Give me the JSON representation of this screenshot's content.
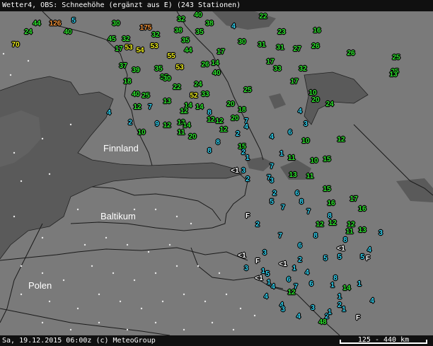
{
  "header": {
    "title": "Wetter4, OBS: Schneehöhe (ergänzt aus E) (243 Stationen)"
  },
  "footer": {
    "timestamp": "Sa, 19.12.2015 06:00z (c) MeteoGroup",
    "scale": "125 - 440 km"
  },
  "regions": [
    {
      "name": "Finnland",
      "label": "Finnland"
    },
    {
      "name": "Baltikum",
      "label": "Baltikum"
    },
    {
      "name": "Polen",
      "label": "Polen"
    }
  ],
  "colors": {
    "land": "#7a7a7a",
    "sea": "#5c5c5c",
    "cyan": "#33d6f5",
    "green": "#2ee62e",
    "yellow": "#f0f01e",
    "orange": "#f5963c",
    "white": "#ffffff"
  },
  "observations": [
    {
      "v": "44",
      "c": "green"
    },
    {
      "v": "126",
      "c": "orange"
    },
    {
      "v": "5",
      "c": "cyan"
    },
    {
      "v": "24",
      "c": "green"
    },
    {
      "v": "40",
      "c": "green"
    },
    {
      "v": "70",
      "c": "yellow"
    },
    {
      "v": "30",
      "c": "green"
    },
    {
      "v": "175",
      "c": "orange"
    },
    {
      "v": "32",
      "c": "green"
    },
    {
      "v": "40",
      "c": "green"
    },
    {
      "v": "38",
      "c": "green"
    },
    {
      "v": "22",
      "c": "green"
    },
    {
      "v": "32",
      "c": "green"
    },
    {
      "v": "38",
      "c": "green"
    },
    {
      "v": "35",
      "c": "green"
    },
    {
      "v": "4",
      "c": "cyan"
    },
    {
      "v": "16",
      "c": "green"
    },
    {
      "v": "23",
      "c": "green"
    },
    {
      "v": "45",
      "c": "green"
    },
    {
      "v": "32",
      "c": "green"
    },
    {
      "v": "31",
      "c": "green"
    },
    {
      "v": "17",
      "c": "green"
    },
    {
      "v": "53",
      "c": "yellow"
    },
    {
      "v": "54",
      "c": "yellow"
    },
    {
      "v": "53",
      "c": "yellow"
    },
    {
      "v": "35",
      "c": "green"
    },
    {
      "v": "30",
      "c": "green"
    },
    {
      "v": "31",
      "c": "green"
    },
    {
      "v": "27",
      "c": "green"
    },
    {
      "v": "26",
      "c": "green"
    },
    {
      "v": "26",
      "c": "green"
    },
    {
      "v": "44",
      "c": "green"
    },
    {
      "v": "17",
      "c": "green"
    },
    {
      "v": "55",
      "c": "yellow"
    },
    {
      "v": "25",
      "c": "green"
    },
    {
      "v": "25",
      "c": "green"
    },
    {
      "v": "37",
      "c": "green"
    },
    {
      "v": "39",
      "c": "green"
    },
    {
      "v": "35",
      "c": "green"
    },
    {
      "v": "53",
      "c": "yellow"
    },
    {
      "v": "26",
      "c": "green"
    },
    {
      "v": "14",
      "c": "green"
    },
    {
      "v": "17",
      "c": "green"
    },
    {
      "v": "33",
      "c": "green"
    },
    {
      "v": "32",
      "c": "green"
    },
    {
      "v": "13",
      "c": "green"
    },
    {
      "v": "40",
      "c": "green"
    },
    {
      "v": "35",
      "c": "green"
    },
    {
      "v": "18",
      "c": "green"
    },
    {
      "v": "30",
      "c": "green"
    },
    {
      "v": "22",
      "c": "green"
    },
    {
      "v": "24",
      "c": "green"
    },
    {
      "v": "17",
      "c": "green"
    },
    {
      "v": "25",
      "c": "green"
    },
    {
      "v": "40",
      "c": "green"
    },
    {
      "v": "25",
      "c": "green"
    },
    {
      "v": "52",
      "c": "yellow"
    },
    {
      "v": "33",
      "c": "green"
    },
    {
      "v": "10",
      "c": "green"
    },
    {
      "v": "20",
      "c": "green"
    },
    {
      "v": "24",
      "c": "green"
    },
    {
      "v": "12",
      "c": "green"
    },
    {
      "v": "7",
      "c": "cyan"
    },
    {
      "v": "13",
      "c": "green"
    },
    {
      "v": "14",
      "c": "green"
    },
    {
      "v": "14",
      "c": "green"
    },
    {
      "v": "20",
      "c": "green"
    },
    {
      "v": "4",
      "c": "cyan"
    },
    {
      "v": "12",
      "c": "green"
    },
    {
      "v": "8",
      "c": "cyan"
    },
    {
      "v": "18",
      "c": "green"
    },
    {
      "v": "4",
      "c": "cyan"
    },
    {
      "v": "2",
      "c": "cyan"
    },
    {
      "v": "9",
      "c": "cyan"
    },
    {
      "v": "12",
      "c": "green"
    },
    {
      "v": "13",
      "c": "green"
    },
    {
      "v": "14",
      "c": "green"
    },
    {
      "v": "12",
      "c": "green"
    },
    {
      "v": "20",
      "c": "green"
    },
    {
      "v": "7",
      "c": "cyan"
    },
    {
      "v": "3",
      "c": "cyan"
    },
    {
      "v": "4",
      "c": "cyan"
    },
    {
      "v": "10",
      "c": "green"
    },
    {
      "v": "11",
      "c": "green"
    },
    {
      "v": "12",
      "c": "green"
    },
    {
      "v": "20",
      "c": "green"
    },
    {
      "v": "12",
      "c": "green"
    },
    {
      "v": "2",
      "c": "cyan"
    },
    {
      "v": "4",
      "c": "cyan"
    },
    {
      "v": "6",
      "c": "cyan"
    },
    {
      "v": "8",
      "c": "cyan"
    },
    {
      "v": "10",
      "c": "green"
    },
    {
      "v": "12",
      "c": "green"
    },
    {
      "v": "8",
      "c": "cyan"
    },
    {
      "v": "15",
      "c": "green"
    },
    {
      "v": "2",
      "c": "cyan"
    },
    {
      "v": "1",
      "c": "cyan"
    },
    {
      "v": "1",
      "c": "cyan"
    },
    {
      "v": "11",
      "c": "green"
    },
    {
      "v": "10",
      "c": "green"
    },
    {
      "v": "15",
      "c": "green"
    },
    {
      "v": "7",
      "c": "cyan"
    },
    {
      "v": "<1",
      "c": "white"
    },
    {
      "v": "3",
      "c": "cyan"
    },
    {
      "v": "7",
      "c": "cyan"
    },
    {
      "v": "13",
      "c": "green"
    },
    {
      "v": "11",
      "c": "green"
    },
    {
      "v": "2",
      "c": "cyan"
    },
    {
      "v": "3",
      "c": "cyan"
    },
    {
      "v": "15",
      "c": "green"
    },
    {
      "v": "2",
      "c": "cyan"
    },
    {
      "v": "6",
      "c": "cyan"
    },
    {
      "v": "8",
      "c": "cyan"
    },
    {
      "v": "17",
      "c": "green"
    },
    {
      "v": "5",
      "c": "cyan"
    },
    {
      "v": "7",
      "c": "cyan"
    },
    {
      "v": "16",
      "c": "green"
    },
    {
      "v": "16",
      "c": "green"
    },
    {
      "v": "F",
      "c": "white"
    },
    {
      "v": "7",
      "c": "cyan"
    },
    {
      "v": "8",
      "c": "cyan"
    },
    {
      "v": "12",
      "c": "green"
    },
    {
      "v": "2",
      "c": "cyan"
    },
    {
      "v": "12",
      "c": "green"
    },
    {
      "v": "11",
      "c": "green"
    },
    {
      "v": "13",
      "c": "green"
    },
    {
      "v": "3",
      "c": "cyan"
    },
    {
      "v": "7",
      "c": "cyan"
    },
    {
      "v": "8",
      "c": "cyan"
    },
    {
      "v": "12",
      "c": "green"
    },
    {
      "v": "8",
      "c": "cyan"
    },
    {
      "v": "3",
      "c": "cyan"
    },
    {
      "v": "5",
      "c": "cyan"
    },
    {
      "v": "5",
      "c": "cyan"
    },
    {
      "v": "5",
      "c": "cyan"
    },
    {
      "v": "2",
      "c": "cyan"
    },
    {
      "v": "4",
      "c": "cyan"
    },
    {
      "v": "6",
      "c": "cyan"
    },
    {
      "v": "<1",
      "c": "white"
    },
    {
      "v": "F",
      "c": "white"
    },
    {
      "v": "<1",
      "c": "white"
    },
    {
      "v": "F",
      "c": "white"
    },
    {
      "v": "<1",
      "c": "white"
    },
    {
      "v": "3",
      "c": "cyan"
    },
    {
      "v": "1",
      "c": "cyan"
    },
    {
      "v": "1",
      "c": "cyan"
    },
    {
      "v": "5",
      "c": "cyan"
    },
    {
      "v": "<1",
      "c": "white"
    },
    {
      "v": "4",
      "c": "cyan"
    },
    {
      "v": "8",
      "c": "cyan"
    },
    {
      "v": "1",
      "c": "cyan"
    },
    {
      "v": "6",
      "c": "cyan"
    },
    {
      "v": "1",
      "c": "cyan"
    },
    {
      "v": "4",
      "c": "cyan"
    },
    {
      "v": "6",
      "c": "cyan"
    },
    {
      "v": "7",
      "c": "cyan"
    },
    {
      "v": "1",
      "c": "cyan"
    },
    {
      "v": "4",
      "c": "cyan"
    },
    {
      "v": "12",
      "c": "green"
    },
    {
      "v": "14",
      "c": "green"
    },
    {
      "v": "1",
      "c": "cyan"
    },
    {
      "v": "4",
      "c": "cyan"
    },
    {
      "v": "4",
      "c": "cyan"
    },
    {
      "v": "2",
      "c": "cyan"
    },
    {
      "v": "3",
      "c": "cyan"
    },
    {
      "v": "1",
      "c": "cyan"
    },
    {
      "v": "2",
      "c": "cyan"
    },
    {
      "v": "3",
      "c": "cyan"
    },
    {
      "v": "1",
      "c": "cyan"
    },
    {
      "v": "F",
      "c": "white"
    },
    {
      "v": "4",
      "c": "cyan"
    },
    {
      "v": "48",
      "c": "green"
    }
  ]
}
